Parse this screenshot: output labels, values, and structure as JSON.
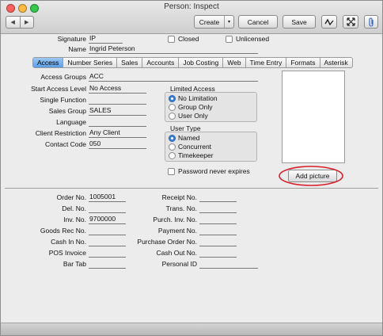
{
  "window": {
    "title": "Person: Inspect"
  },
  "toolbar": {
    "prev": "◀",
    "next": "▶",
    "create": "Create",
    "create_arrow": "▾",
    "cancel": "Cancel",
    "save": "Save",
    "icons": [
      "signature-icon",
      "expand-icon",
      "attach-icon"
    ]
  },
  "header": {
    "signature_label": "Signature",
    "signature_value": "IP",
    "name_label": "Name",
    "name_value": "Ingrid Peterson",
    "closed_label": "Closed",
    "unlicensed_label": "Unlicensed"
  },
  "tabs": [
    "Access",
    "Number Series",
    "Sales",
    "Accounts",
    "Job Costing",
    "Web",
    "Time Entry",
    "Formats",
    "Asterisk"
  ],
  "access": {
    "access_groups_label": "Access Groups",
    "access_groups_value": "ACC",
    "start_level_label": "Start Access Level",
    "start_level_value": "No Access",
    "single_function_label": "Single Function",
    "single_function_value": "",
    "sales_group_label": "Sales Group",
    "sales_group_value": "SALES",
    "language_label": "Language",
    "language_value": "",
    "client_restriction_label": "Client Restriction",
    "client_restriction_value": "Any Client",
    "contact_code_label": "Contact Code",
    "contact_code_value": "050"
  },
  "limited_access": {
    "title": "Limited Access",
    "options": [
      "No Limitation",
      "Group Only",
      "User Only"
    ],
    "selected": "No Limitation"
  },
  "user_type": {
    "title": "User Type",
    "options": [
      "Named",
      "Concurrent",
      "Timekeeper"
    ],
    "selected": "Named"
  },
  "password_never_expires_label": "Password never expires",
  "add_picture_label": "Add picture",
  "lower_left": [
    {
      "label": "Order No.",
      "value": "1005001"
    },
    {
      "label": "Del. No.",
      "value": ""
    },
    {
      "label": "Inv. No.",
      "value": "9700000"
    },
    {
      "label": "Goods Rec No.",
      "value": ""
    },
    {
      "label": "Cash In No.",
      "value": ""
    },
    {
      "label": "POS Invoice",
      "value": ""
    },
    {
      "label": "Bar Tab",
      "value": ""
    }
  ],
  "lower_right": [
    {
      "label": "Receipt No.",
      "value": ""
    },
    {
      "label": "Trans. No.",
      "value": ""
    },
    {
      "label": "Purch. Inv. No.",
      "value": ""
    },
    {
      "label": "Payment No.",
      "value": ""
    },
    {
      "label": "Purchase Order No.",
      "value": ""
    },
    {
      "label": "Cash Out No.",
      "value": ""
    },
    {
      "label": "Personal ID",
      "value": ""
    }
  ],
  "colors": {
    "close": "#fc605c",
    "minimize": "#fdbc40",
    "zoom": "#34c84a",
    "active_tab": "#6aa8ea",
    "annotation": "#d8202a"
  }
}
